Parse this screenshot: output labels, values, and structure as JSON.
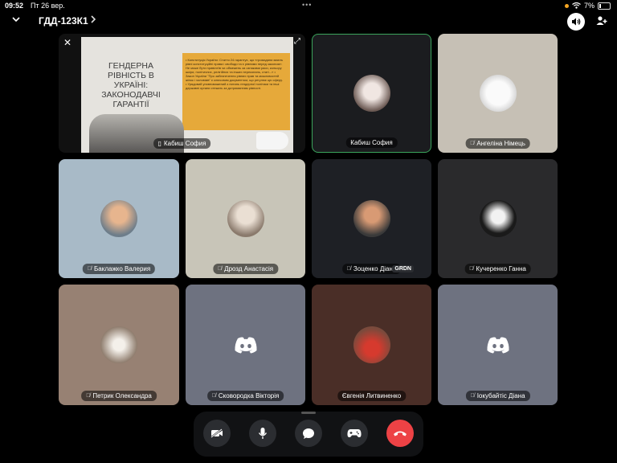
{
  "status": {
    "time": "09:52",
    "date": "Пт 26 вер.",
    "battery": "7%"
  },
  "header": {
    "channel": "ГДД-123К1"
  },
  "share": {
    "slide_title": "ГЕНДЕРНА РІВНІСТЬ В УКРАЇНІ: ЗАКОНОДАВЧІ ГАРАНТІЇ",
    "slide_text": "• Конституція України: Стаття 24 гарантує, що «громадяни мають рівні конституційні права і свободи та є рівними перед законом». Не може бути привілеїв чи обмежень за ознаками раси, кольору шкіри, політичних, релігійних та інших переконань, статі...» • Закон України \"Про забезпечення рівних прав та можливостей жінок і чоловіків\" є ключовим документом, що регулює цю сферу. • Урядовий уповноважений з питань гендерної політики та інші державні органи стежать за дотриманням рівності.",
    "presenter": "Кабиш София"
  },
  "tiles": [
    {
      "name": "Кабиш София"
    },
    {
      "name": "Ангеліна Німець"
    },
    {
      "name": "Баклажко Валерия"
    },
    {
      "name": "Дрозд Анастасія"
    },
    {
      "name": "Зоценко Діана",
      "badge": "GRDN"
    },
    {
      "name": "Кучеренко Ганна"
    },
    {
      "name": "Петрик Олександра"
    },
    {
      "name": "Сковородка Вікторія"
    },
    {
      "name": "Євгенія Литвиненко"
    },
    {
      "name": "Іокубайтіс Діана"
    }
  ],
  "colors": {
    "end_call": "#ed4245",
    "speaking_border": "#3ba55c",
    "tile_gray": "#6e7280"
  }
}
